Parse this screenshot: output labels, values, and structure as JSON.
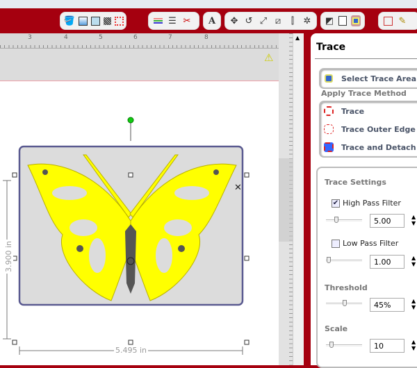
{
  "toolbar": {
    "groups": [
      [
        "fill-icon",
        "color-icon",
        "pattern-icon",
        "texture-icon",
        "shadow-icon"
      ],
      [
        "line-color-icon",
        "line-style-icon",
        "cut-icon"
      ],
      [
        "text-icon"
      ],
      [
        "move-icon",
        "rotate-icon",
        "resize-icon",
        "skew-icon",
        "align-icon",
        "weld-icon"
      ],
      [
        "print-mode-icon",
        "page-icon",
        "trace-icon"
      ],
      [
        "shape-icon",
        "pencil-icon"
      ]
    ],
    "text_glyph": "A"
  },
  "ruler": {
    "labels": [
      "3",
      "4",
      "5",
      "6",
      "7",
      "8"
    ]
  },
  "selection": {
    "width": "5.495 in",
    "height": "3.900 in"
  },
  "panel": {
    "title": "Trace",
    "select_area": "Select Trace Area",
    "apply_heading": "Apply Trace Method",
    "methods": [
      "Trace",
      "Trace Outer Edge",
      "Trace and Detach"
    ],
    "settings_heading": "Trace Settings",
    "high_pass": {
      "label": "High Pass Filter",
      "checked": true,
      "value": "5.00",
      "slider": 0.25
    },
    "low_pass": {
      "label": "Low Pass Filter",
      "checked": false,
      "value": "1.00",
      "slider": 0.05
    },
    "threshold": {
      "label": "Threshold",
      "value": "45%",
      "slider": 0.45
    },
    "scale": {
      "label": "Scale",
      "value": "10",
      "slider": 0.1
    }
  },
  "colors": {
    "brand": "#a5000f",
    "trace": "#ffff00",
    "body": "#555555"
  }
}
